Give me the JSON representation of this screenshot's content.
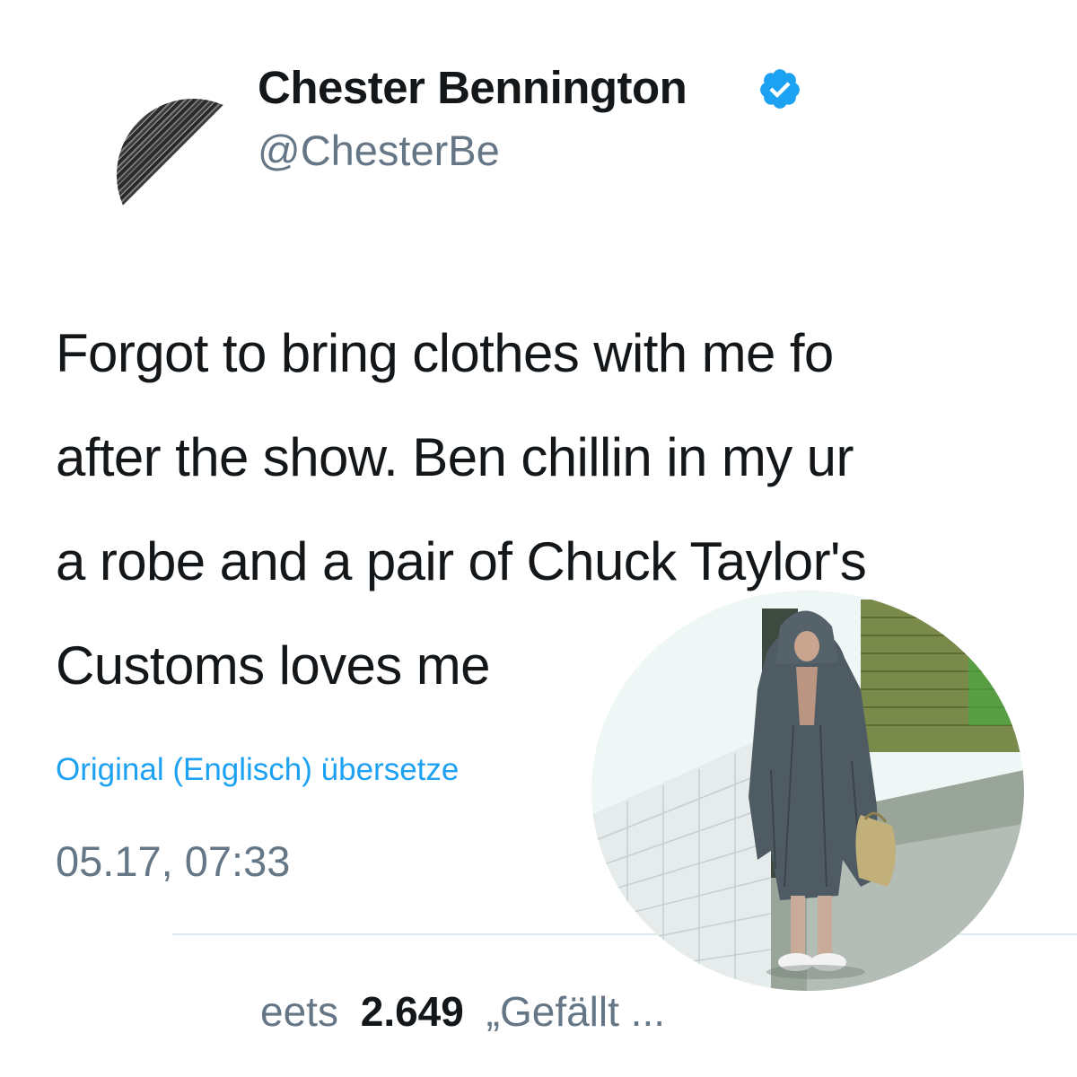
{
  "tweet": {
    "display_name": "Chester Bennington",
    "handle": "@ChesterBe",
    "verified": true,
    "text_lines": [
      "Forgot to bring clothes with me fo",
      "after the show. Ben chillin in my ur",
      "a robe and a pair of Chuck Taylor's",
      "Customs loves me"
    ],
    "translate_link": "Original (Englisch) übersetze",
    "timestamp": "05.17, 07:33",
    "stats": {
      "retweets_label": "eets",
      "likes_count": "2.649",
      "likes_label": "„Gefällt ..."
    }
  },
  "colors": {
    "text": "#14171a",
    "secondary": "#657786",
    "link": "#1da1f2",
    "verified": "#1da1f2",
    "divider": "#e1e8ed"
  },
  "icons": {
    "verified": "verified-badge-icon"
  }
}
